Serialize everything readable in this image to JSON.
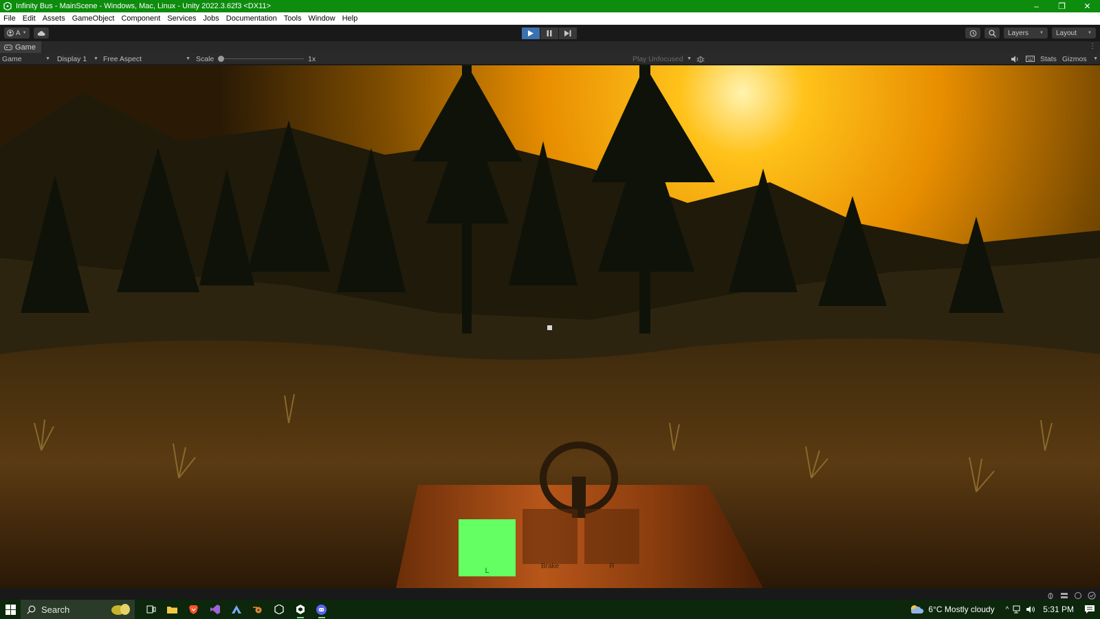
{
  "window": {
    "title": "Infinity Bus - MainScene - Windows, Mac, Linux - Unity 2022.3.62f3 <DX11>",
    "minimize": "–",
    "restore": "❐",
    "close": "✕"
  },
  "menu": [
    "File",
    "Edit",
    "Assets",
    "GameObject",
    "Component",
    "Services",
    "Jobs",
    "Documentation",
    "Tools",
    "Window",
    "Help"
  ],
  "toolbar": {
    "account_label": "A",
    "layers_label": "Layers",
    "layout_label": "Layout"
  },
  "game_tab": {
    "label": "Game"
  },
  "game_bar": {
    "view_mode": "Game",
    "display": "Display 1",
    "aspect": "Free Aspect",
    "scale_label": "Scale",
    "scale_value": "1x",
    "play_mode": "Play Unfocused",
    "stats": "Stats",
    "gizmos": "Gizmos"
  },
  "hud": {
    "left_indicator": "L",
    "middle_indicator": "Brake",
    "right_indicator": "R"
  },
  "taskbar": {
    "search_placeholder": "Search",
    "weather": "6°C  Mostly cloudy",
    "time": "5:31 PM"
  },
  "colors": {
    "title_bar": "#0d8c0d",
    "taskbar": "#0c270c",
    "hud_green": "#63ff63",
    "play_active": "#3a72b0",
    "sky_glow": "#ffb000"
  }
}
